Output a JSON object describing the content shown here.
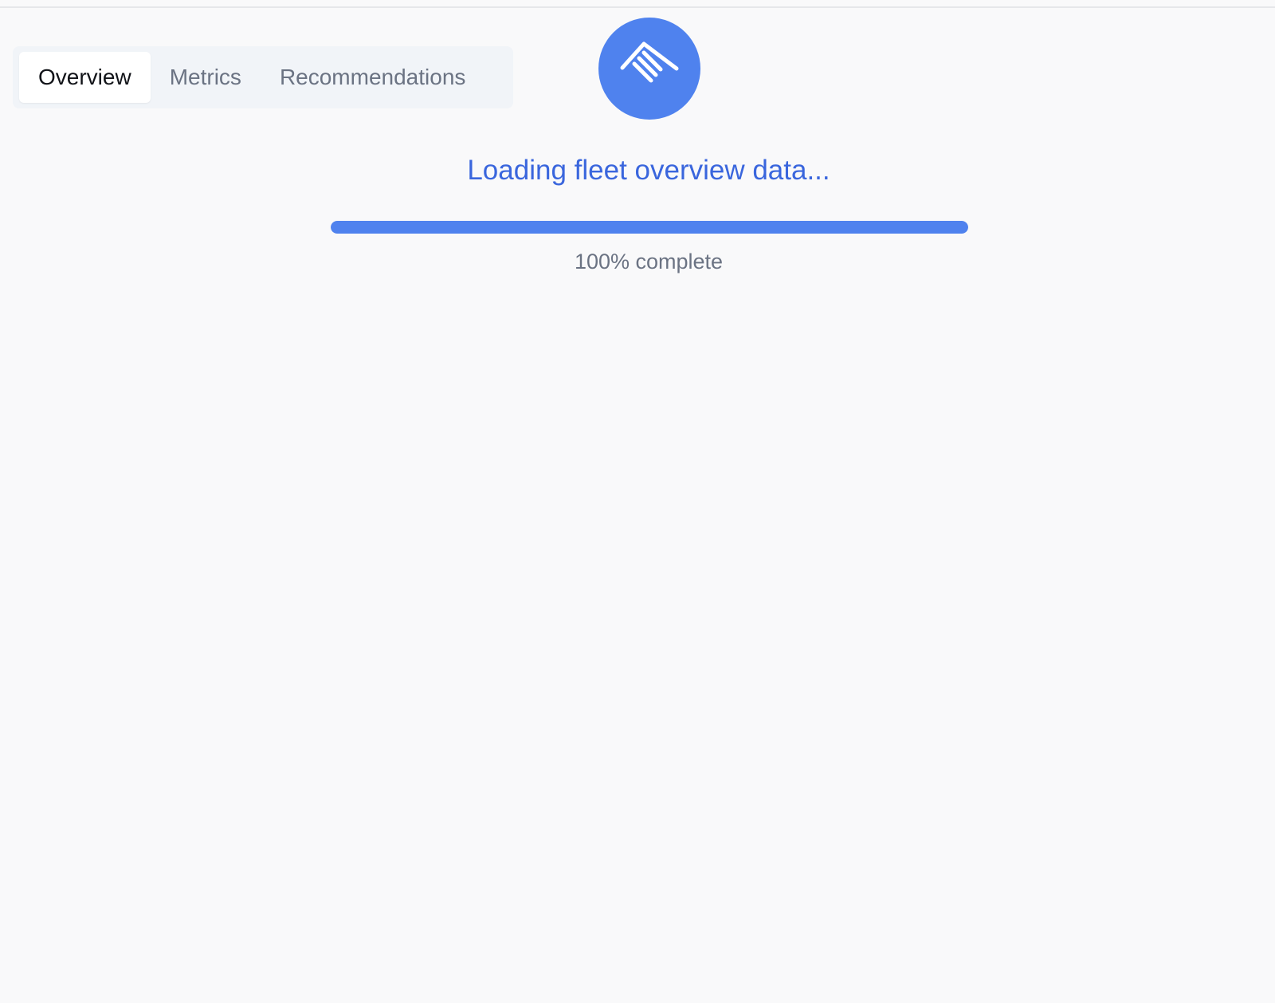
{
  "tabs": [
    {
      "label": "Overview",
      "active": true
    },
    {
      "label": "Metrics",
      "active": false
    },
    {
      "label": "Recommendations",
      "active": false
    }
  ],
  "logo": {
    "icon": "roof-lines-icon",
    "color": "#4f82ee"
  },
  "loading": {
    "title": "Loading fleet overview data...",
    "progress_text": "100% complete",
    "progress_fraction": 1.0
  },
  "colors": {
    "accent": "#4f82ee",
    "title": "#3a66dd",
    "muted_text": "#6b7383"
  }
}
